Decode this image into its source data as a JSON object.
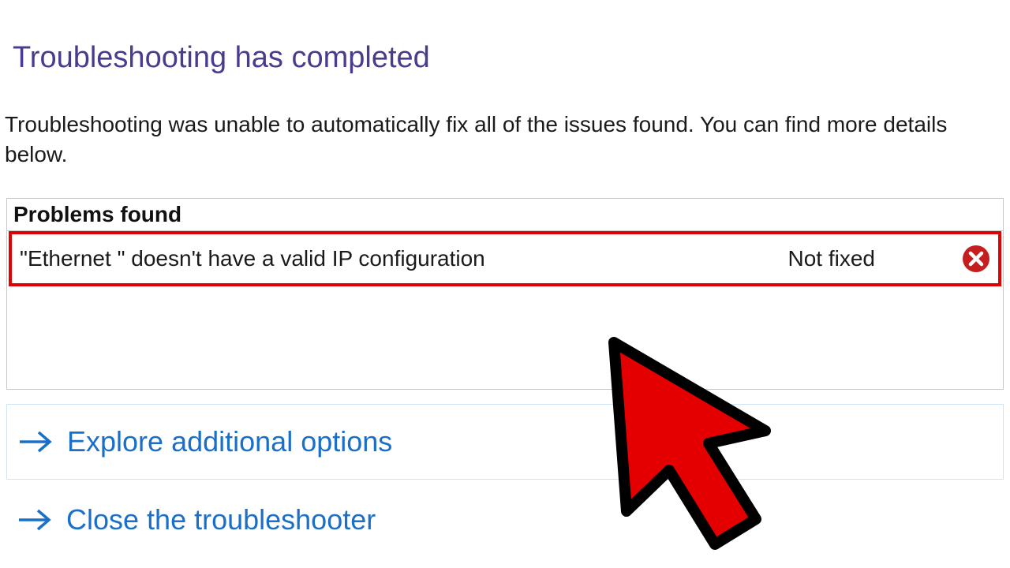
{
  "header": {
    "title": "Troubleshooting has completed",
    "subtitle": "Troubleshooting was unable to automatically fix all of the issues found. You can find more details below."
  },
  "problems": {
    "header": "Problems found",
    "items": [
      {
        "description": "\"Ethernet \" doesn't have a valid IP configuration",
        "status": "Not fixed",
        "icon": "error-x-icon"
      }
    ]
  },
  "options": {
    "explore": "Explore additional options",
    "close": "Close the troubleshooter"
  }
}
